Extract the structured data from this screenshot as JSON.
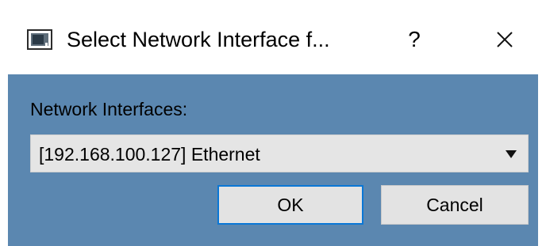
{
  "window": {
    "title": "Select Network Interface f...",
    "help_label": "?",
    "icons": {
      "app": "app-window-icon",
      "close": "close-icon",
      "dropdown": "dropdown-arrow-icon"
    }
  },
  "form": {
    "label": "Network Interfaces:",
    "selected_interface": "[192.168.100.127] Ethernet"
  },
  "buttons": {
    "ok_label": "OK",
    "cancel_label": "Cancel"
  },
  "colors": {
    "dialog_background": "#5b87b0",
    "focus_border": "#0a77d6",
    "button_background": "#e3e3e3"
  }
}
